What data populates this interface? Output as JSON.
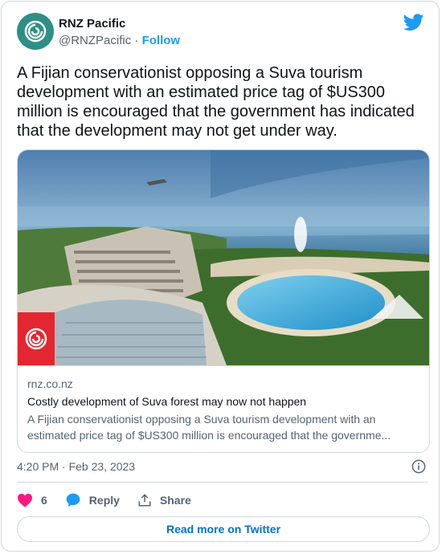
{
  "author": {
    "name": "RNZ Pacific",
    "handle": "@RNZPacific",
    "separator": "·",
    "follow_label": "Follow",
    "avatar_color": "#2d8f86"
  },
  "platform_icon": "twitter-bird-icon",
  "tweet": {
    "text": "A Fijian conservationist opposing a Suva tourism development with an estimated price tag of $US300 million is encouraged that the government has indicated that the development may not get under way."
  },
  "link_card": {
    "domain": "rnz.co.nz",
    "title": "Costly development of Suva forest may now not happen",
    "description_line1": "A Fijian conservationist opposing a Suva tourism development with an",
    "description_line2": "estimated price tag of $US300 million is encouraged that the governme...",
    "badge_color": "#e3262f"
  },
  "meta": {
    "timestamp": "4:20 PM · Feb 23, 2023"
  },
  "actions": {
    "like_count": "6",
    "reply_label": "Reply",
    "share_label": "Share",
    "like_color": "#f91880",
    "reply_color": "#1d9bf0"
  },
  "read_more_label": "Read more on Twitter"
}
